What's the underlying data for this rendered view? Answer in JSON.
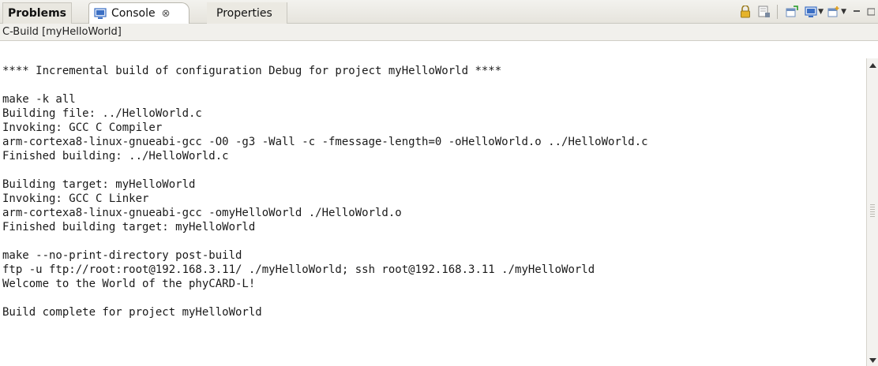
{
  "tabs": {
    "problems": "Problems",
    "console": "Console",
    "console_close": "⊗",
    "properties": "Properties"
  },
  "toolbar": {
    "icons": [
      "scroll-lock-icon",
      "clear-console-icon",
      "pin-console-icon",
      "display-console-icon",
      "open-console-icon",
      "minimize-icon",
      "maximize-icon"
    ]
  },
  "console": {
    "title": "C-Build [myHelloWorld]",
    "lines": [
      "**** Incremental build of configuration Debug for project myHelloWorld ****",
      "",
      "make -k all",
      "Building file: ../HelloWorld.c",
      "Invoking: GCC C Compiler",
      "arm-cortexa8-linux-gnueabi-gcc -O0 -g3 -Wall -c -fmessage-length=0 -oHelloWorld.o ../HelloWorld.c",
      "Finished building: ../HelloWorld.c",
      "",
      "Building target: myHelloWorld",
      "Invoking: GCC C Linker",
      "arm-cortexa8-linux-gnueabi-gcc -omyHelloWorld ./HelloWorld.o",
      "Finished building target: myHelloWorld",
      "",
      "make --no-print-directory post-build",
      "ftp -u ftp://root:root@192.168.3.11/ ./myHelloWorld; ssh root@192.168.3.11 ./myHelloWorld",
      "Welcome to the World of the phyCARD-L!",
      "",
      "Build complete for project myHelloWorld"
    ]
  },
  "colors": {
    "tab_bar": "#e6e4dd",
    "accent_blue": "#3b6fc4",
    "lock_gold": "#d9a21b"
  }
}
